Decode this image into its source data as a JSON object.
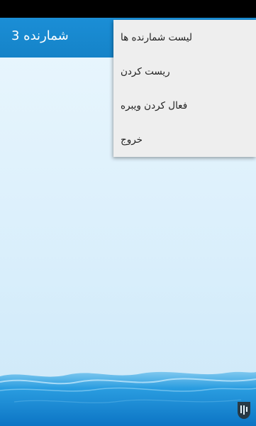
{
  "app_bar": {
    "title": "شمارنده 3"
  },
  "menu": {
    "items": [
      {
        "label": "لیست شمارنده ها"
      },
      {
        "label": "ریست کردن"
      },
      {
        "label": "فعال کردن ویبره"
      },
      {
        "label": "خروج"
      }
    ]
  },
  "colors": {
    "accent": "#1583c8",
    "background": "#dff0fb",
    "menu_bg": "#eeeeee"
  }
}
